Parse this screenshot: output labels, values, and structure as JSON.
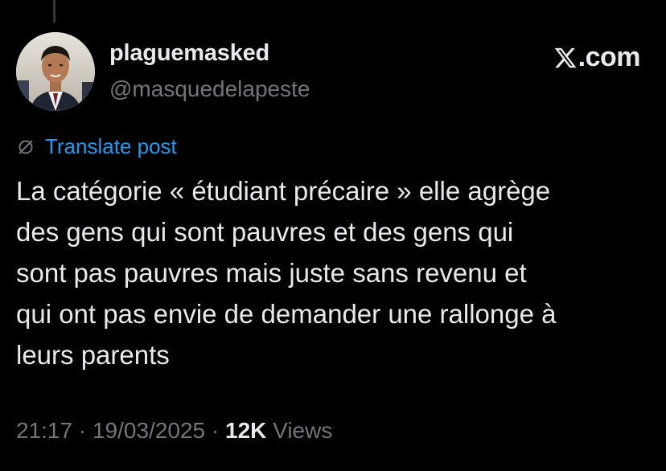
{
  "author": {
    "display_name": "plaguemasked",
    "handle": "@masquedelapeste"
  },
  "brand": {
    "label": ".com",
    "icon": "x-logo-icon"
  },
  "translate": {
    "label": "Translate post",
    "icon": "globe-slash-icon"
  },
  "post": {
    "text": "La catégorie « étudiant précaire » elle agrège\ndes gens qui sont pauvres et des gens qui\nsont pas pauvres mais juste sans revenu et\nqui ont pas envie de demander une rallonge à\nleurs parents"
  },
  "meta": {
    "time": "21:17",
    "separator": " · ",
    "date": "19/03/2025",
    "views_count": "12K",
    "views_label": " Views"
  },
  "colors": {
    "background": "#000000",
    "text": "#e7e9ea",
    "muted": "#71767b",
    "link": "#1d9bf0"
  }
}
